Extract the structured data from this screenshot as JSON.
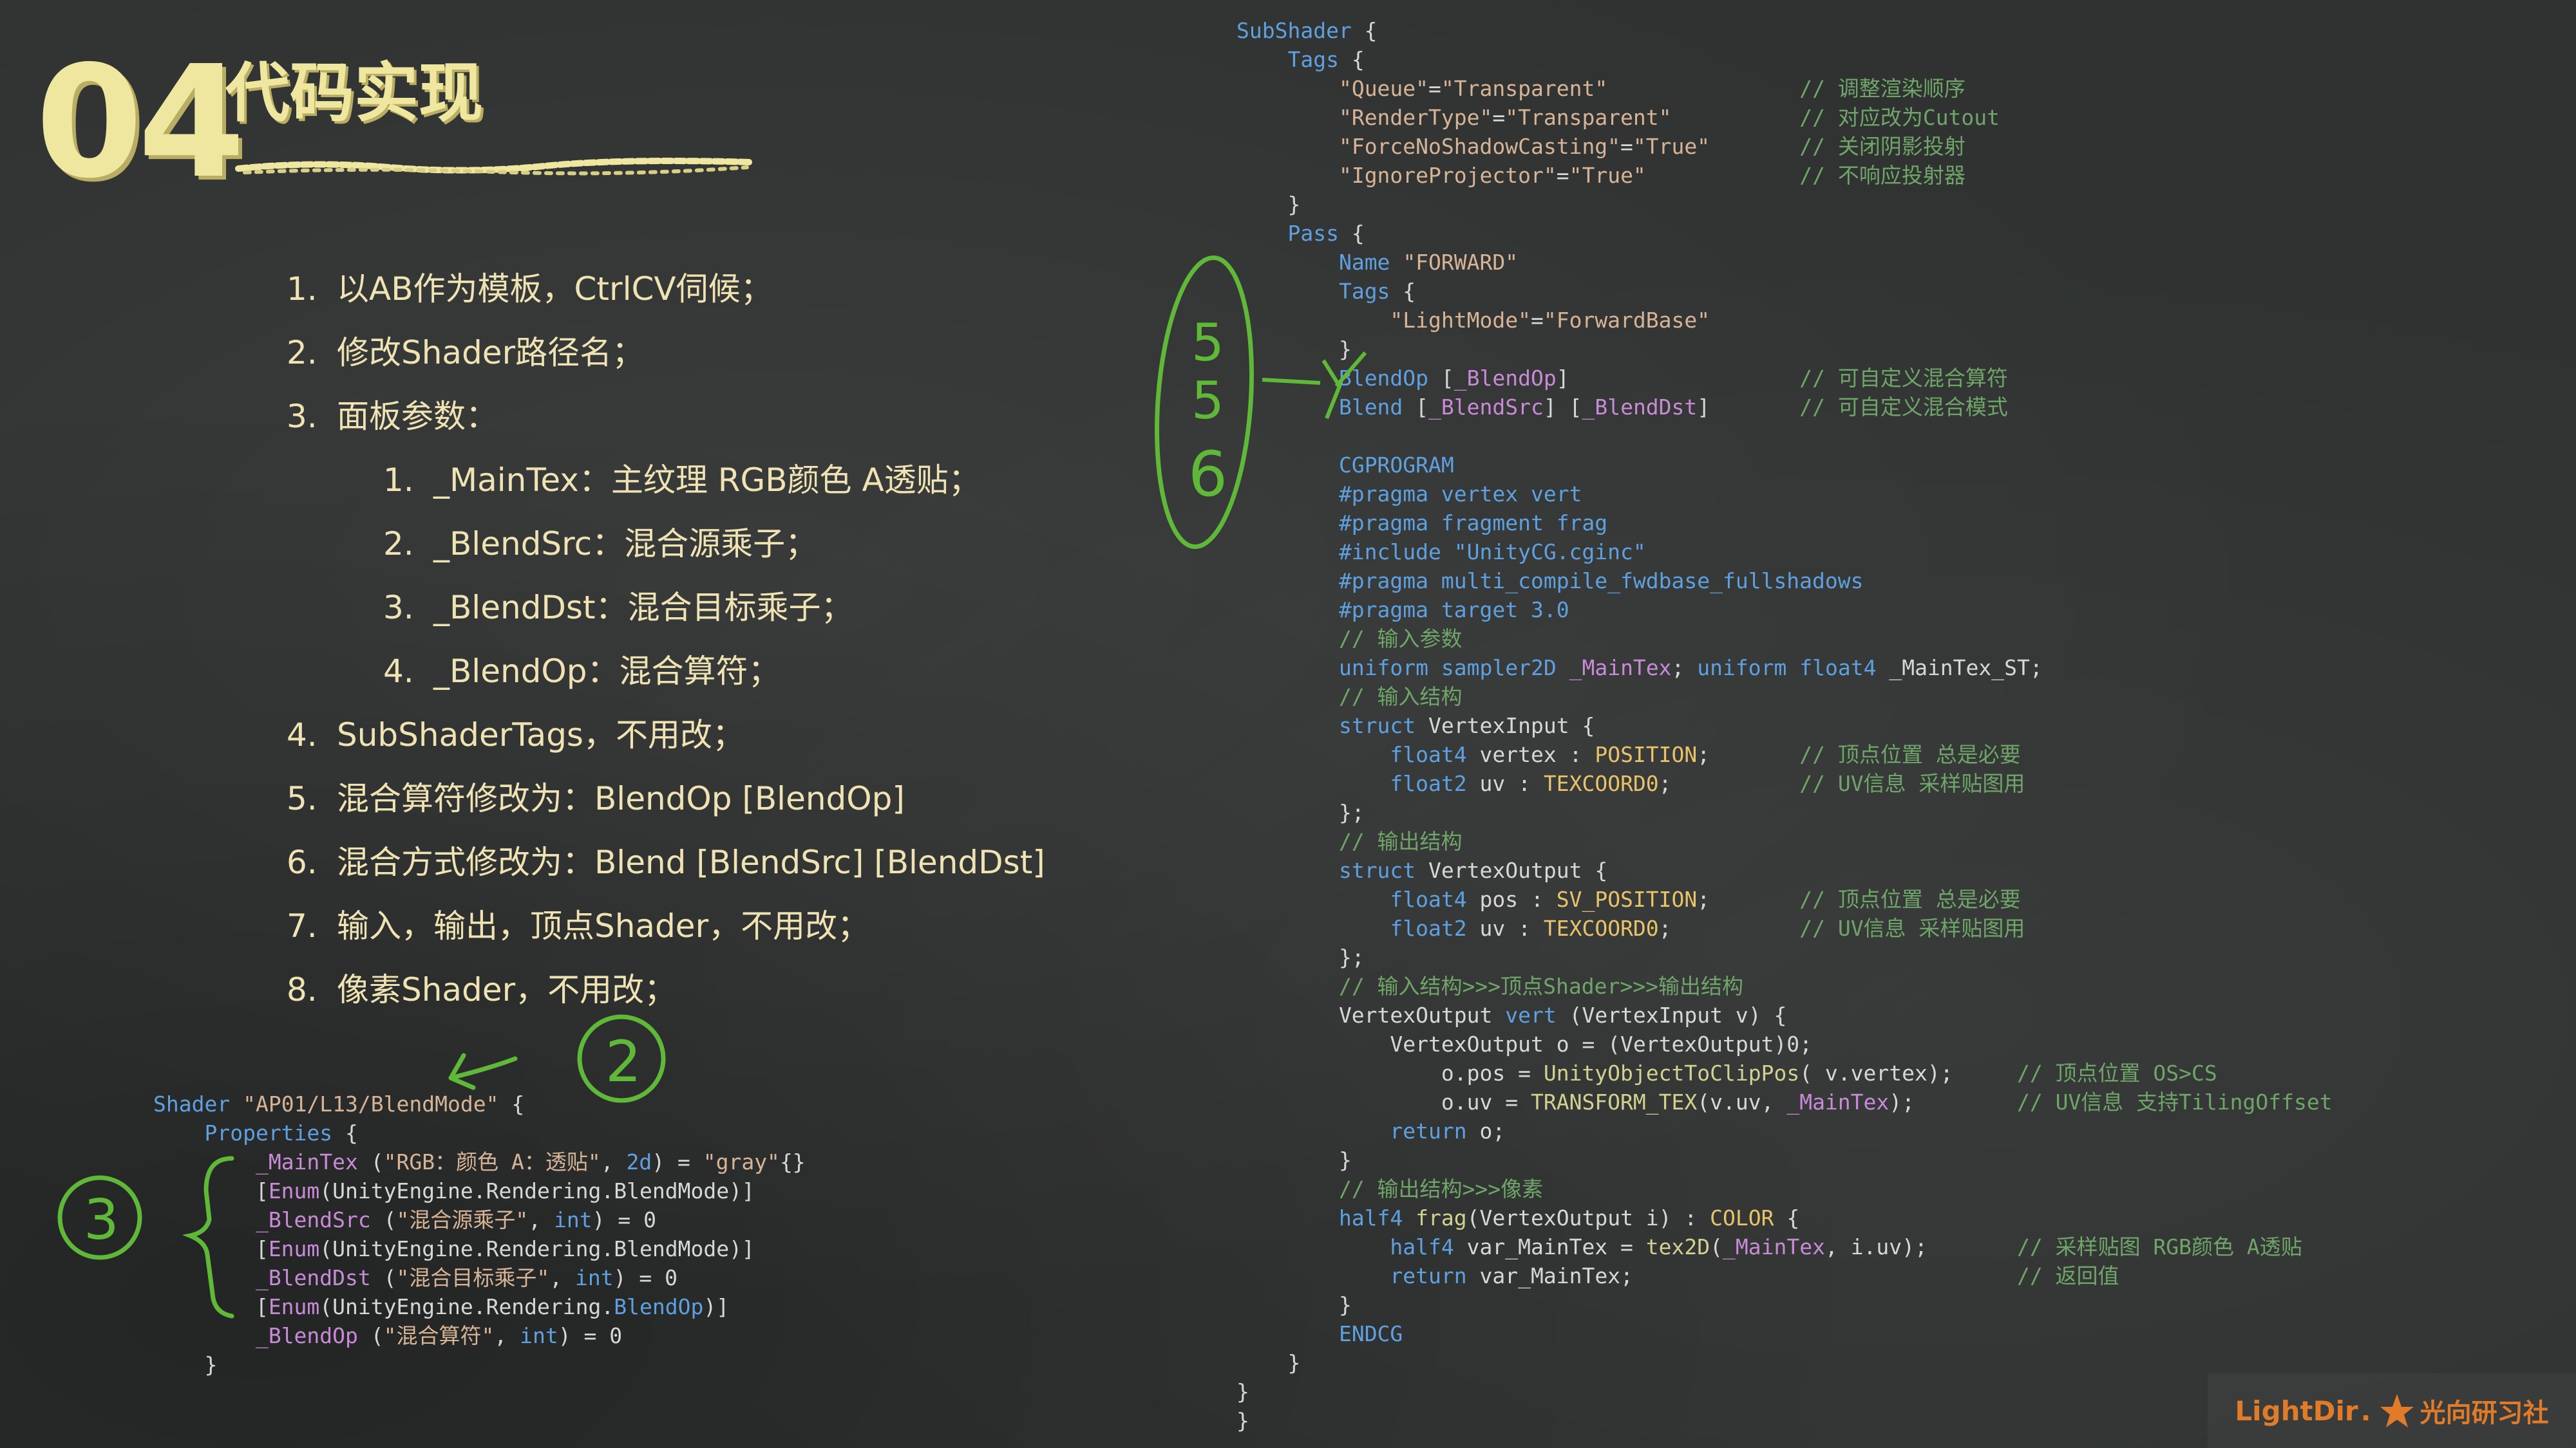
{
  "heading": {
    "number": "04",
    "title": "代码实现"
  },
  "colors": {
    "chalk_yellow": "#efe6a0",
    "chalk_green": "#5fb838",
    "text": "#efe2b3",
    "code_keyword": "#5ea0e0",
    "code_string": "#d8b496",
    "code_comment": "#6fa568",
    "brand": "#e07b2a"
  },
  "steps": [
    {
      "num": "1.",
      "text": "以AB作为模板，CtrlCV伺候；",
      "level": 1
    },
    {
      "num": "2.",
      "text": "修改Shader路径名；",
      "level": 1
    },
    {
      "num": "3.",
      "text": "面板参数：",
      "level": 1
    },
    {
      "num": "1.",
      "text": "_MainTex：主纹理 RGB颜色 A透贴；",
      "level": 2
    },
    {
      "num": "2.",
      "text": "_BlendSrc：混合源乘子；",
      "level": 2
    },
    {
      "num": "3.",
      "text": "_BlendDst：混合目标乘子；",
      "level": 2
    },
    {
      "num": "4.",
      "text": "_BlendOp：混合算符；",
      "level": 2
    },
    {
      "num": "4.",
      "text": "SubShaderTags，不用改；",
      "level": 1
    },
    {
      "num": "5.",
      "text": "混合算符修改为：BlendOp [BlendOp]",
      "level": 1
    },
    {
      "num": "6.",
      "text": "混合方式修改为：Blend [BlendSrc] [BlendDst]",
      "level": 1
    },
    {
      "num": "7.",
      "text": "输入，输出，顶点Shader，不用改；",
      "level": 1
    },
    {
      "num": "8.",
      "text": "像素Shader，不用改；",
      "level": 1
    }
  ],
  "annotations": {
    "label_2": "2",
    "label_3": "3",
    "label_5": "5",
    "label_5b": "5",
    "label_6": "6"
  },
  "code_left": [
    "Shader \"AP01/L13/BlendMode\" {",
    "    Properties {",
    "        _MainTex (\"RGB：颜色 A：透贴\", 2d) = \"gray\"{}",
    "        [Enum(UnityEngine.Rendering.BlendMode)]",
    "        _BlendSrc (\"混合源乘子\", int) = 0",
    "        [Enum(UnityEngine.Rendering.BlendMode)]",
    "        _BlendDst (\"混合目标乘子\", int) = 0",
    "        [Enum(UnityEngine.Rendering.BlendOp)]",
    "        _BlendOp (\"混合算符\", int) = 0",
    "    }"
  ],
  "code_right": [
    "SubShader {",
    "    Tags {",
    "        \"Queue\"=\"Transparent\"               // 调整渲染顺序",
    "        \"RenderType\"=\"Transparent\"          // 对应改为Cutout",
    "        \"ForceNoShadowCasting\"=\"True\"       // 关闭阴影投射",
    "        \"IgnoreProjector\"=\"True\"            // 不响应投射器",
    "    }",
    "    Pass {",
    "        Name \"FORWARD\"",
    "        Tags {",
    "            \"LightMode\"=\"ForwardBase\"",
    "        }",
    "        BlendOp [_BlendOp]                  // 可自定义混合算符",
    "        Blend [_BlendSrc] [_BlendDst]       // 可自定义混合模式",
    "",
    "        CGPROGRAM",
    "        #pragma vertex vert",
    "        #pragma fragment frag",
    "        #include \"UnityCG.cginc\"",
    "        #pragma multi_compile_fwdbase_fullshadows",
    "        #pragma target 3.0",
    "        // 输入参数",
    "        uniform sampler2D _MainTex; uniform float4 _MainTex_ST;",
    "        // 输入结构",
    "        struct VertexInput {",
    "            float4 vertex : POSITION;       // 顶点位置 总是必要",
    "            float2 uv : TEXCOORD0;          // UV信息 采样贴图用",
    "        };",
    "        // 输出结构",
    "        struct VertexOutput {",
    "            float4 pos : SV_POSITION;       // 顶点位置 总是必要",
    "            float2 uv : TEXCOORD0;          // UV信息 采样贴图用",
    "        };",
    "        // 输入结构>>>顶点Shader>>>输出结构",
    "        VertexOutput vert (VertexInput v) {",
    "            VertexOutput o = (VertexOutput)0;",
    "                o.pos = UnityObjectToClipPos( v.vertex);     // 顶点位置 OS>CS",
    "                o.uv = TRANSFORM_TEX(v.uv, _MainTex);        // UV信息 支持TilingOffset",
    "            return o;",
    "        }",
    "        // 输出结构>>>像素",
    "        half4 frag(VertexOutput i) : COLOR {",
    "            half4 var_MainTex = tex2D(_MainTex, i.uv);       // 采样贴图 RGB颜色 A透贴",
    "            return var_MainTex;                              // 返回值",
    "        }",
    "        ENDCG",
    "    }",
    "}",
    "}"
  ],
  "logo": {
    "brand": "LightDir",
    "separator": ".",
    "chinese": "光向研习社"
  }
}
